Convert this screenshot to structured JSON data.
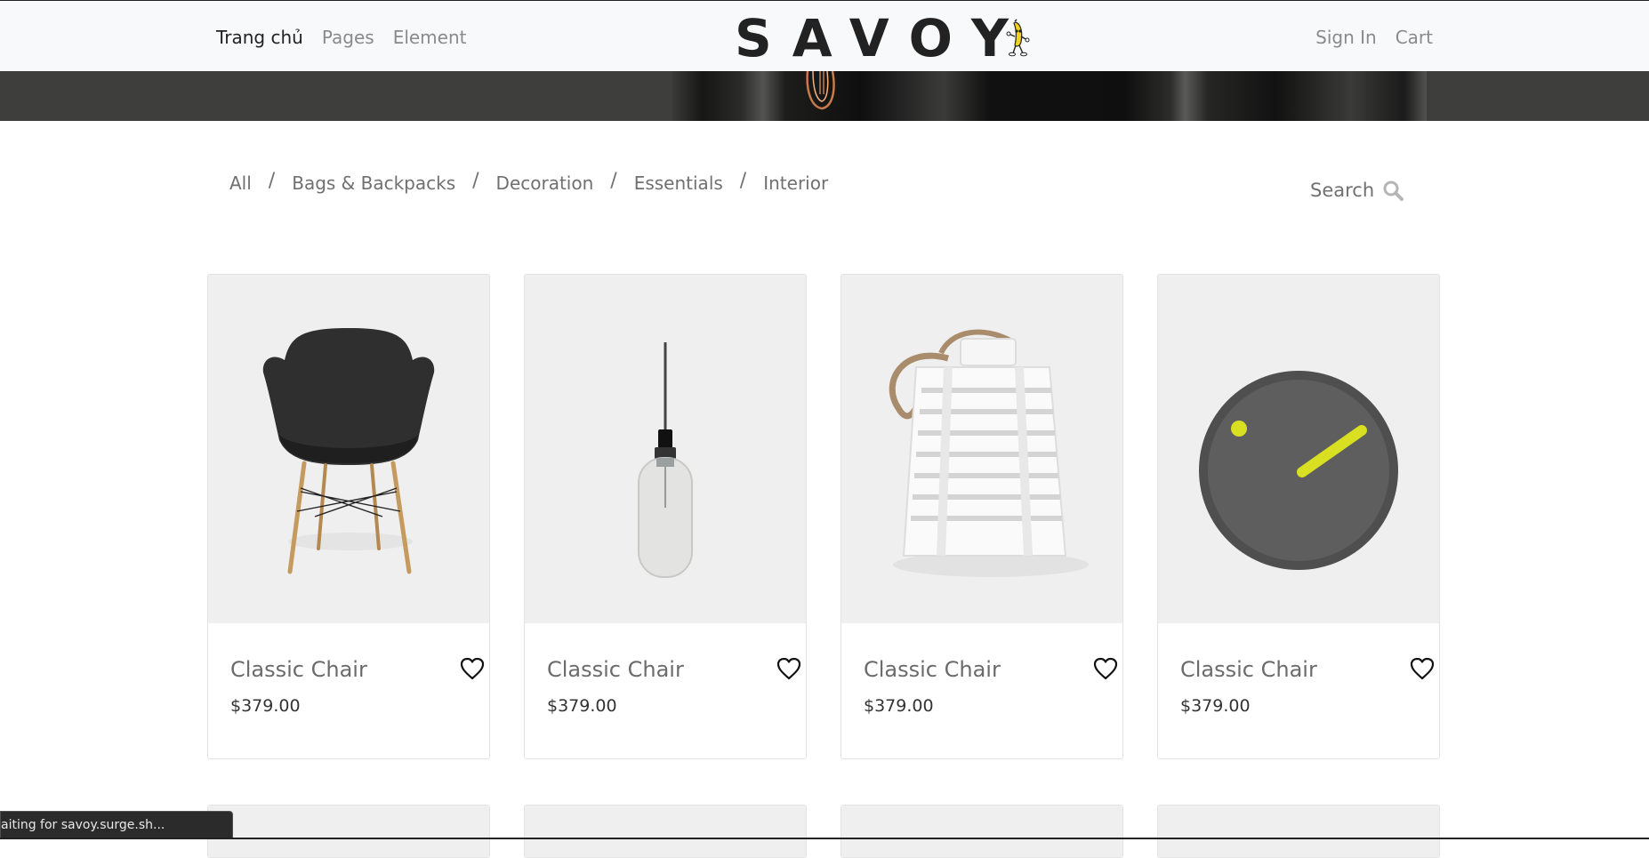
{
  "header": {
    "nav_left": [
      "Trang chủ",
      "Pages",
      "Element"
    ],
    "logo": "SAVOY",
    "nav_right": [
      "Sign In",
      "Cart"
    ]
  },
  "filters": {
    "categories": [
      "All",
      "Bags & Backpacks",
      "Decoration",
      "Essentials",
      "Interior"
    ],
    "separator": "/",
    "search_label": "Search"
  },
  "products": [
    {
      "name": "Classic Chair",
      "price": "$379.00",
      "image": "black-chair"
    },
    {
      "name": "Classic Chair",
      "price": "$379.00",
      "image": "pendant-lamp"
    },
    {
      "name": "Classic Chair",
      "price": "$379.00",
      "image": "white-lantern"
    },
    {
      "name": "Classic Chair",
      "price": "$379.00",
      "image": "wall-clock"
    }
  ],
  "status_bar": {
    "text": "aiting for savoy.surge.sh..."
  },
  "colors": {
    "accent": "#d9e021",
    "text_dark": "#222222",
    "muted": "#8a8a8a",
    "card_bg": "#efefef"
  }
}
